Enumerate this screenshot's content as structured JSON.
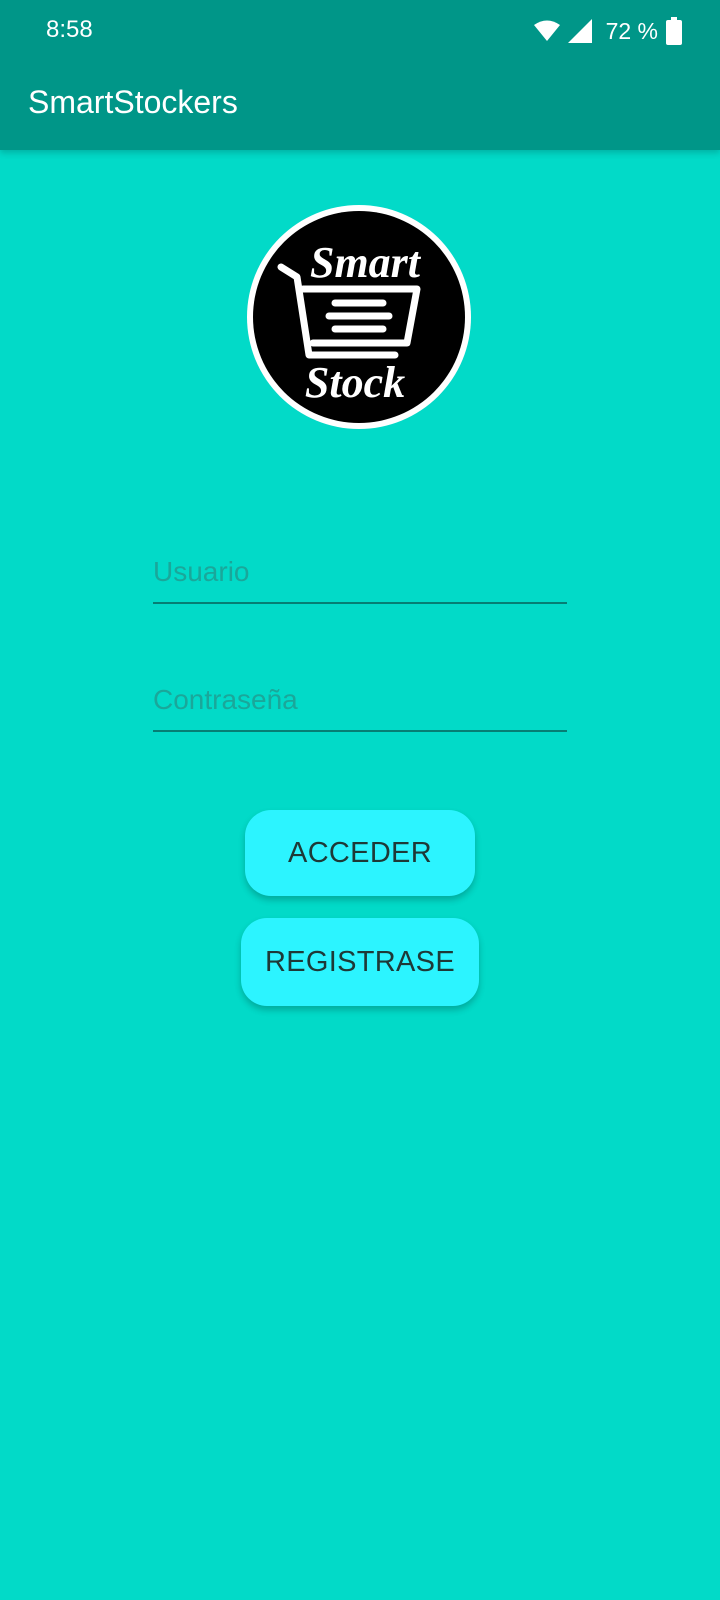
{
  "status_bar": {
    "time": "8:58",
    "battery": "72 %",
    "icons": [
      "wifi-icon",
      "cell-signal-icon",
      "battery-icon"
    ]
  },
  "app_bar": {
    "title": "SmartStockers",
    "color": "#009688"
  },
  "logo": {
    "top_text": "Smart",
    "bottom_text": "Stock",
    "icon": "shopping-cart-icon"
  },
  "login": {
    "username_placeholder": "Usuario",
    "password_placeholder": "Contraseña",
    "username_value": "",
    "password_value": ""
  },
  "buttons": {
    "login_label": "ACCEDER",
    "register_label": "REGISTRASE"
  },
  "colors": {
    "background": "#02dac8",
    "button": "#2cf4ff"
  }
}
